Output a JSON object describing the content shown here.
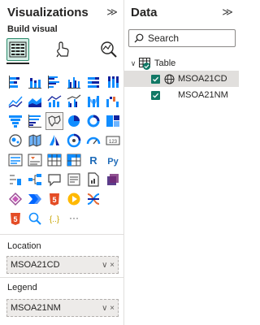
{
  "viz_pane": {
    "title": "Visualizations",
    "collapse_glyph": "≫",
    "build_label": "Build visual",
    "tabs": [
      {
        "name": "build-visual-tab-icon",
        "active": true
      },
      {
        "name": "format-visual-tab-icon",
        "active": false
      },
      {
        "name": "analytics-tab-icon",
        "active": false
      }
    ],
    "visuals": [
      "stacked-bar-chart-icon",
      "stacked-column-chart-icon",
      "clustered-bar-chart-icon",
      "clustered-column-chart-icon",
      "100-stacked-bar-chart-icon",
      "100-stacked-column-chart-icon",
      "line-chart-icon",
      "stacked-area-chart-icon",
      "line-and-stacked-column-icon",
      "line-and-clustered-column-icon",
      "ribbon-chart-icon",
      "waterfall-chart-icon",
      "funnel-chart-icon",
      "scatter-chart-icon",
      "pie-chart-icon",
      "donut-chart-icon",
      "treemap-icon",
      "map-icon",
      "filled-map-icon",
      "shape-map-icon",
      "azure-map-icon",
      "gauge-icon",
      "card-icon",
      "multi-row-card-icon",
      "kpi-icon",
      "slicer-icon",
      "table-icon",
      "matrix-icon",
      "r-script-visual-icon",
      "python-visual-icon",
      "key-influencers-icon",
      "decomposition-tree-icon",
      "qa-icon",
      "smart-narrative-icon",
      "paginated-report-icon",
      "power-apps-icon",
      "power-automate-icon",
      "html-content-icon",
      "play-axis-icon",
      "sankey-icon",
      "html5-icon",
      "search-icon",
      "custom-visual-icon",
      "more-visuals-icon"
    ],
    "selected_visual": "shape-map-icon",
    "r_glyph": "R",
    "py_glyph": "Py",
    "card_glyph": "123",
    "html5_glyph": "5",
    "custom_glyph": "{..}",
    "more_glyph": "···",
    "wells": [
      {
        "label": "Location",
        "value": "MSOA21CD",
        "controls": "∨ ×"
      },
      {
        "label": "Legend",
        "value": "MSOA21NM",
        "controls": "∨ ×"
      }
    ]
  },
  "data_pane": {
    "title": "Data",
    "close_glyph": "≫",
    "search": {
      "placeholder": "Search"
    },
    "table": {
      "name": "Table",
      "chevron": "∨"
    },
    "fields": [
      {
        "name": "MSOA21CD",
        "checked": true,
        "geo": true
      },
      {
        "name": "MSOA21NM",
        "checked": true,
        "geo": false
      }
    ]
  },
  "colors": {
    "accent": "#117865",
    "highlight": "#e1dfdd",
    "well_bg": "#edebe9"
  }
}
